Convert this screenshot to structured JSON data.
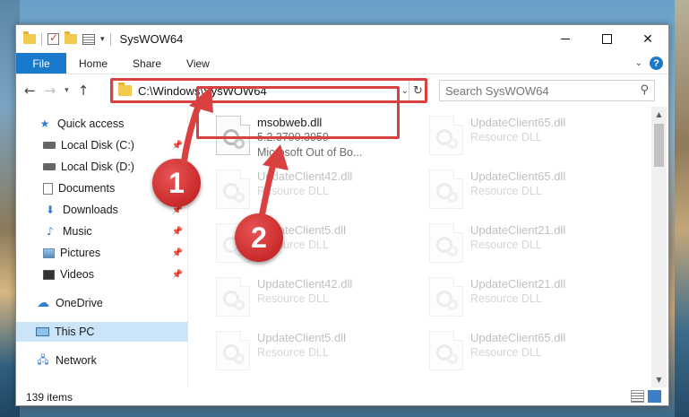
{
  "window": {
    "title": "SysWOW64"
  },
  "ribbon": {
    "tabs": [
      "File",
      "Home",
      "Share",
      "View"
    ]
  },
  "address": {
    "path": "C:\\Windows\\SysWOW64",
    "search_placeholder": "Search SysWOW64"
  },
  "sidebar": {
    "items": [
      {
        "label": "Quick access",
        "icon": "star-icon"
      },
      {
        "label": "Local Disk (C:)",
        "icon": "drive-icon"
      },
      {
        "label": "Local Disk (D:)",
        "icon": "drive-icon"
      },
      {
        "label": "Documents",
        "icon": "document-icon"
      },
      {
        "label": "Downloads",
        "icon": "download-icon"
      },
      {
        "label": "Music",
        "icon": "music-icon"
      },
      {
        "label": "Pictures",
        "icon": "pictures-icon"
      },
      {
        "label": "Videos",
        "icon": "videos-icon"
      },
      {
        "label": "OneDrive",
        "icon": "cloud-icon"
      },
      {
        "label": "This PC",
        "icon": "computer-icon"
      },
      {
        "label": "Network",
        "icon": "network-icon"
      }
    ]
  },
  "files": [
    {
      "name": "msobweb.dll",
      "version": "5.2.3790.3959",
      "desc": "Microsoft Out of Bo..."
    },
    {
      "name": "UpdateClient65.dll",
      "desc": "Resource DLL"
    },
    {
      "name": "UpdateClient42.dll",
      "desc": "Resource DLL"
    },
    {
      "name": "UpdateClient65.dll",
      "desc": "Resource DLL"
    },
    {
      "name": "UpdateClient5.dll",
      "desc": "Resource DLL"
    },
    {
      "name": "UpdateClient21.dll",
      "desc": "Resource DLL"
    },
    {
      "name": "UpdateClient42.dll",
      "desc": "Resource DLL"
    },
    {
      "name": "UpdateClient21.dll",
      "desc": "Resource DLL"
    },
    {
      "name": "UpdateClient5.dll",
      "desc": "Resource DLL"
    },
    {
      "name": "UpdateClient65.dll",
      "desc": "Resource DLL"
    }
  ],
  "status": {
    "item_count": "139 items"
  },
  "callouts": [
    "1",
    "2"
  ],
  "colors": {
    "accent": "#1979ca",
    "highlight": "#d94040",
    "selection": "#cce4f7"
  }
}
